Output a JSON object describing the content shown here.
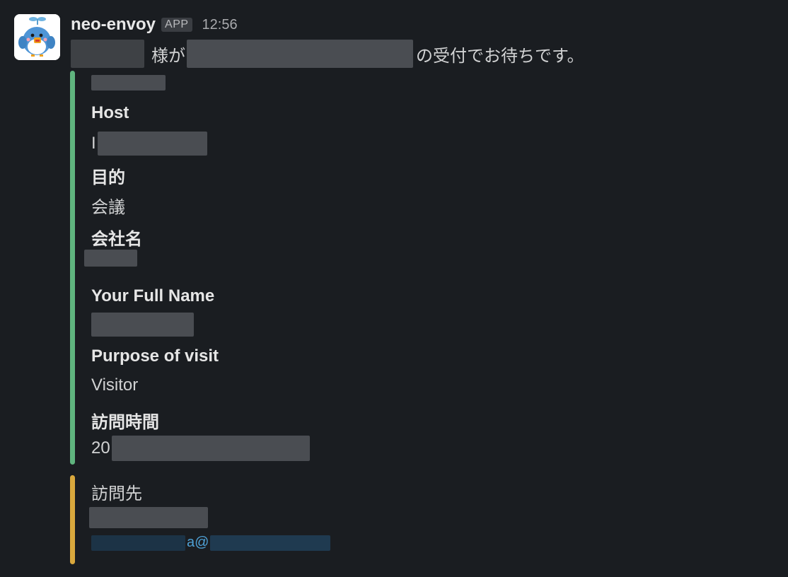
{
  "message": {
    "sender": "neo-envoy",
    "badge": "APP",
    "time": "12:56",
    "text_mid": "様が",
    "text_end": "の受付でお待ちです。"
  },
  "fields": {
    "host_label": "Host",
    "host_value_prefix": "I",
    "purpose_jp_label": "目的",
    "purpose_jp_value": "会議",
    "company_label": "会社名",
    "full_name_label": "Your Full Name",
    "purpose_en_label": "Purpose of visit",
    "purpose_en_value": "Visitor",
    "visit_time_label": "訪問時間",
    "visit_time_value_prefix": "20"
  },
  "destination": {
    "label": "訪問先",
    "email_visible": "a@"
  },
  "colors": {
    "background": "#1a1d21",
    "green_bar": "#5fb47e",
    "yellow_bar": "#d9a83d",
    "link": "#4ea1d6"
  }
}
